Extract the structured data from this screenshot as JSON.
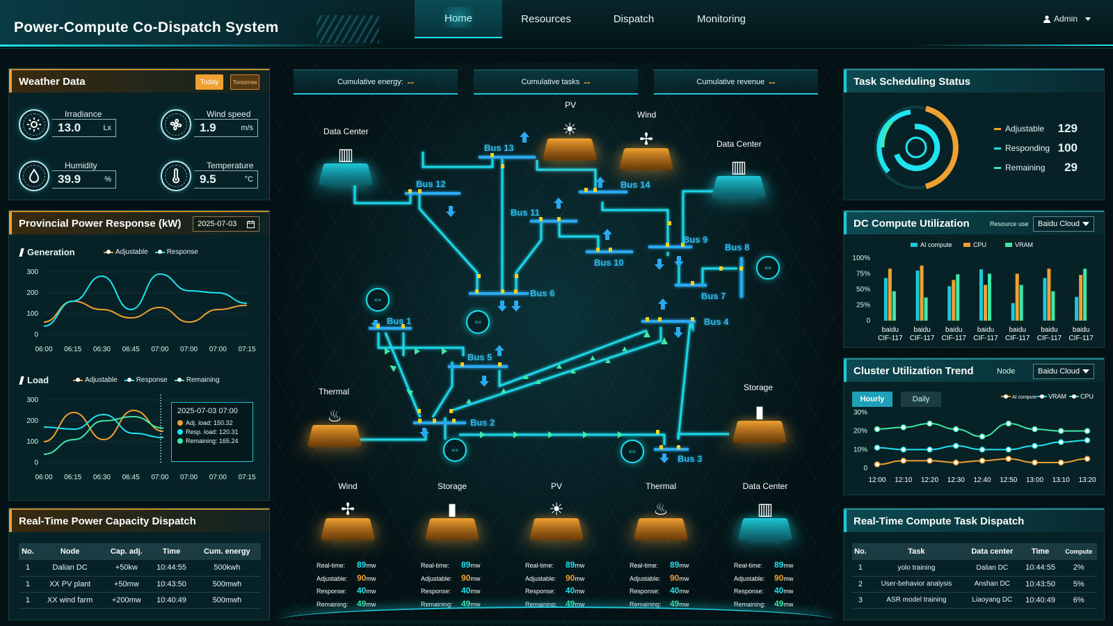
{
  "header": {
    "title": "Power-Compute Co-Dispatch System",
    "nav": [
      "Home",
      "Resources",
      "Dispatch",
      "Monitoring"
    ],
    "user": "Admin"
  },
  "weather": {
    "title": "Weather Data",
    "today": "Today",
    "tomorrow": "Tomorrow",
    "items": [
      {
        "label": "Irradiance",
        "value": "13.0",
        "unit": "Lx",
        "icon": "sun-icon"
      },
      {
        "label": "Wind speed",
        "value": "1.9",
        "unit": "m/s",
        "icon": "fan-icon"
      },
      {
        "label": "Humidity",
        "value": "39.9",
        "unit": "%",
        "icon": "droplet-icon"
      },
      {
        "label": "Temperature",
        "value": "9.5",
        "unit": "°C",
        "icon": "thermometer-icon"
      }
    ]
  },
  "power_response": {
    "title": "Provincial Power Response (kW)",
    "date": "2025-07-03",
    "gen_label": "Generation",
    "load_label": "Load",
    "gen_legend": [
      "Adjustable",
      "Response"
    ],
    "load_legend": [
      "Adjustable",
      "Response",
      "Remaining"
    ],
    "tooltip": {
      "title": "2025-07-03 07:00",
      "rows": [
        "Adj. load:  150.32",
        "Resp. load:  120.31",
        "Remaining:  165.24"
      ]
    }
  },
  "chart_data": [
    {
      "type": "line",
      "title": "Generation",
      "x": [
        "06:00",
        "06:15",
        "06:30",
        "06:45",
        "07:00",
        "07:00",
        "07:00",
        "07:15"
      ],
      "ylim": [
        0,
        300
      ],
      "yticks": [
        0,
        100,
        200,
        300
      ],
      "series": [
        {
          "name": "Adjustable",
          "color": "#f0a030",
          "values": [
            60,
            160,
            120,
            80,
            130,
            60,
            120,
            140
          ]
        },
        {
          "name": "Response",
          "color": "#1ee3f0",
          "values": [
            40,
            160,
            280,
            120,
            290,
            210,
            200,
            150
          ]
        }
      ]
    },
    {
      "type": "line",
      "title": "Load",
      "x": [
        "06:00",
        "06:15",
        "06:30",
        "06:45",
        "07:00",
        "07:00",
        "07:00",
        "07:15"
      ],
      "ylim": [
        0,
        300
      ],
      "yticks": [
        0,
        100,
        200,
        300
      ],
      "series": [
        {
          "name": "Adjustable",
          "color": "#f0a030",
          "values": [
            100,
            240,
            110,
            250,
            150
          ]
        },
        {
          "name": "Response",
          "color": "#1ee3f0",
          "values": [
            170,
            160,
            230,
            140,
            120
          ]
        },
        {
          "name": "Remaining",
          "color": "#3de8a8",
          "values": [
            40,
            110,
            200,
            220,
            165
          ]
        }
      ]
    },
    {
      "type": "bar",
      "title": "DC Compute Utilization",
      "categories": [
        "baidu CIF-117",
        "baidu CIF-117",
        "baidu CIF-117",
        "baidu CIF-117",
        "baidu CIF-117",
        "baidu CIF-117",
        "baidu CIF-117"
      ],
      "ylim": [
        0,
        100
      ],
      "yticks": [
        "0",
        "25%",
        "50%",
        "75%",
        "100%"
      ],
      "series": [
        {
          "name": "AI compute",
          "color": "#1ec8d8",
          "values": [
            68,
            80,
            55,
            82,
            28,
            68,
            38
          ]
        },
        {
          "name": "CPU",
          "color": "#f0a030",
          "values": [
            83,
            88,
            65,
            57,
            75,
            83,
            73
          ]
        },
        {
          "name": "VRAM",
          "color": "#3de8a8",
          "values": [
            47,
            37,
            74,
            75,
            57,
            47,
            83
          ]
        }
      ]
    },
    {
      "type": "line",
      "title": "Cluster Utilization Trend",
      "x": [
        "12:00",
        "12:10",
        "12:20",
        "12:30",
        "12:40",
        "12:50",
        "13:00",
        "13:10",
        "13:20"
      ],
      "ylim": [
        0,
        30
      ],
      "yticks": [
        "0",
        "10%",
        "20%",
        "30%"
      ],
      "series": [
        {
          "name": "AI compute",
          "color": "#f0a030",
          "values": [
            2,
            4,
            4,
            3,
            4,
            5,
            3,
            3,
            5
          ]
        },
        {
          "name": "VRAM",
          "color": "#1ee3f0",
          "values": [
            11,
            10,
            10,
            12,
            10,
            10,
            12,
            14,
            15
          ]
        },
        {
          "name": "CPU",
          "color": "#3de8a8",
          "values": [
            21,
            22,
            24,
            21,
            17,
            24,
            21,
            20,
            20
          ]
        }
      ]
    }
  ],
  "capacity": {
    "title": "Real-Time Power Capacity Dispatch",
    "headers": [
      "No.",
      "Node",
      "Cap. adj.",
      "Time",
      "Cum. energy"
    ],
    "rows": [
      [
        "1",
        "Dalian DC",
        "+50kw",
        "10:44:55",
        "500kwh"
      ],
      [
        "1",
        "XX PV plant",
        "+50mw",
        "10:43:50",
        "500mwh"
      ],
      [
        "1",
        "XX wind farm",
        "+200mw",
        "10:40:49",
        "500mwh"
      ]
    ]
  },
  "stats": {
    "energy": "Cumulative energy:",
    "tasks": "Cumulative tasks",
    "revenue": "Cumulative revenue",
    "dash": "--"
  },
  "map": {
    "nodes": {
      "dc1": "Data Center",
      "pv": "PV",
      "wind": "Wind",
      "dc2": "Data Center",
      "thermal": "Thermal",
      "storage": "Storage"
    },
    "buses": [
      "Bus 1",
      "Bus 2",
      "Bus 3",
      "Bus 4",
      "Bus 5",
      "Bus 6",
      "Bus 7",
      "Bus 8",
      "Bus 9",
      "Bus 10",
      "Bus 11",
      "Bus 12",
      "Bus 13",
      "Bus 14"
    ],
    "bottom": [
      {
        "name": "Wind",
        "icon": "wind-turbine-icon",
        "kind": "orange"
      },
      {
        "name": "Storage",
        "icon": "battery-icon",
        "kind": "orange"
      },
      {
        "name": "PV",
        "icon": "solar-panel-icon",
        "kind": "orange"
      },
      {
        "name": "Thermal",
        "icon": "thermal-plant-icon",
        "kind": "orange"
      },
      {
        "name": "Data Center",
        "icon": "server-icon",
        "kind": "cyan"
      }
    ],
    "stat_labels": [
      "Real-time:",
      "Adjustable:",
      "Response:",
      "Remaining:"
    ],
    "stat_values": [
      "89",
      "90",
      "40",
      "49"
    ],
    "stat_unit": "mw"
  },
  "task_status": {
    "title": "Task Scheduling Status",
    "items": [
      {
        "label": "Adjustable",
        "value": "129",
        "color": "#f0a030"
      },
      {
        "label": "Responding",
        "value": "100",
        "color": "#1ee3f0"
      },
      {
        "label": "Remaining",
        "value": "29",
        "color": "#3de8a8"
      }
    ]
  },
  "dc_util": {
    "title": "DC Compute Utilization",
    "resource_label": "Resource use",
    "select": "Baidu Cloud"
  },
  "cluster": {
    "title": "Cluster Utilization Trend",
    "node_label": "Node",
    "select": "Baidu Cloud",
    "tabs": [
      "Hourly",
      "Daily"
    ]
  },
  "compute_dispatch": {
    "title": "Real-Time Compute Task Dispatch",
    "headers": [
      "No.",
      "Task",
      "Data center",
      "Time",
      "Compute"
    ],
    "rows": [
      [
        "1",
        "yolo training",
        "Dalian DC",
        "10:44:55",
        "2%"
      ],
      [
        "2",
        "User-behavior analysis",
        "Anshan DC",
        "10:43:50",
        "5%"
      ],
      [
        "3",
        "ASR model training",
        "Liaoyang DC",
        "10:40:49",
        "6%"
      ]
    ]
  }
}
